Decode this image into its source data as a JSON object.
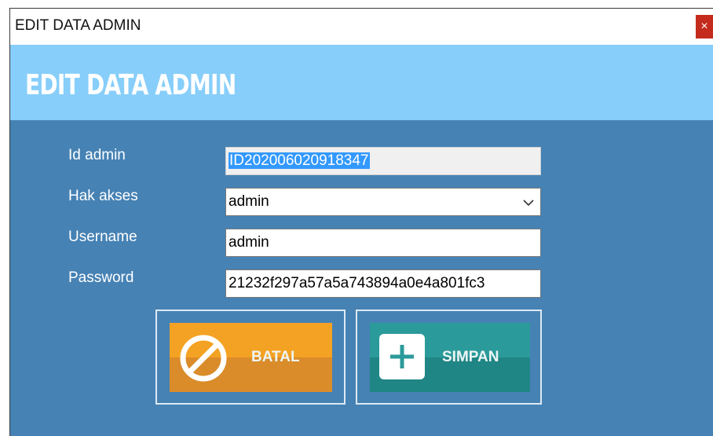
{
  "window": {
    "title": "EDIT DATA ADMIN",
    "close_symbol": "×",
    "heading": "EDIT DATA ADMIN"
  },
  "form": {
    "id_admin": {
      "label": "Id admin",
      "value": "ID202006020918347"
    },
    "hak_akses": {
      "label": "Hak akses",
      "value": "admin"
    },
    "username": {
      "label": "Username",
      "value": "admin"
    },
    "password": {
      "label": "Password",
      "value": "21232f297a57a5a743894a0e4a801fc3"
    }
  },
  "buttons": {
    "batal": "BATAL",
    "simpan": "SIMPAN"
  },
  "colors": {
    "body": "#4682b4",
    "header_band": "#87cefa",
    "batal": "#f4a223",
    "simpan": "#2b9a9a"
  },
  "icons": {
    "batal": "ban-icon",
    "simpan": "plus-icon",
    "select": "chevron-down-icon"
  }
}
